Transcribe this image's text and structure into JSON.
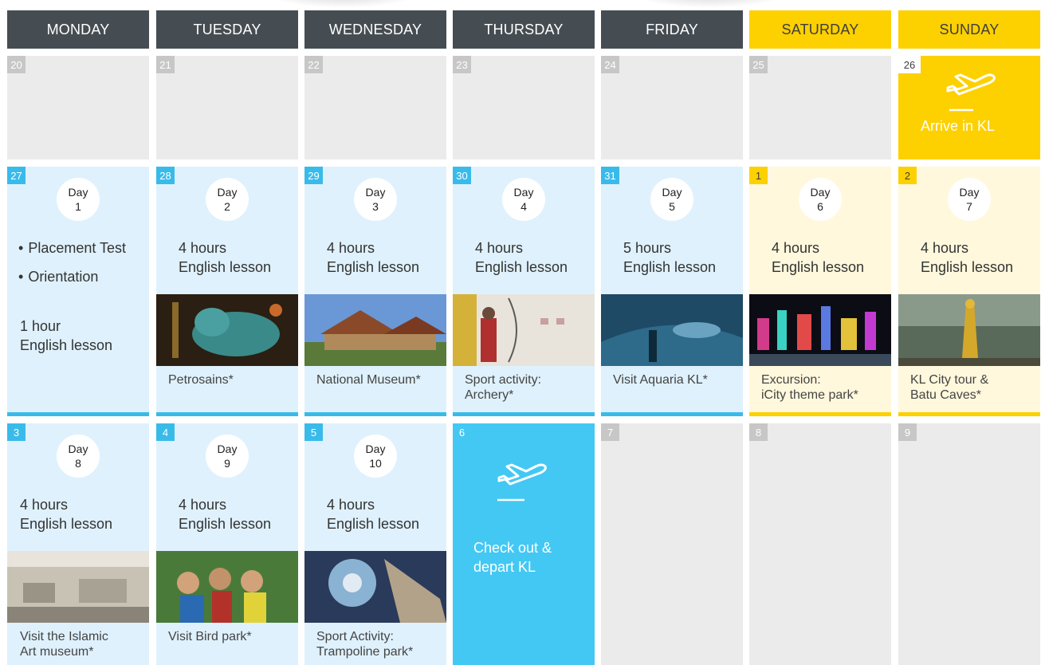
{
  "headers": [
    "MONDAY",
    "TUESDAY",
    "WEDNESDAY",
    "THURSDAY",
    "FRIDAY",
    "SATURDAY",
    "SUNDAY"
  ],
  "week1": {
    "dates": [
      "20",
      "21",
      "22",
      "23",
      "24",
      "25",
      "26"
    ],
    "arrive_label": "Arrive in KL"
  },
  "week2": {
    "dates": [
      "27",
      "28",
      "29",
      "30",
      "31",
      "1",
      "2"
    ],
    "day_word": "Day",
    "day_numbers": [
      "1",
      "2",
      "3",
      "4",
      "5",
      "6",
      "7"
    ],
    "monday_bullets": [
      "Placement Test",
      "Orientation"
    ],
    "monday_lesson": [
      "1 hour",
      "English lesson"
    ],
    "lessons": [
      [
        "4 hours",
        "English lesson"
      ],
      [
        "4 hours",
        "English lesson"
      ],
      [
        "4 hours",
        "English lesson"
      ],
      [
        "5 hours",
        "English lesson"
      ],
      [
        "4 hours",
        "English lesson"
      ],
      [
        "4 hours",
        "English lesson"
      ]
    ],
    "captions": [
      [
        "Petrosains*"
      ],
      [
        "National Museum*"
      ],
      [
        "Sport activity:",
        "Archery*"
      ],
      [
        "Visit Aquaria KL*"
      ],
      [
        "Excursion:",
        "iCity theme park*"
      ],
      [
        "KL City tour &",
        "Batu Caves*"
      ]
    ]
  },
  "week3": {
    "dates": [
      "3",
      "4",
      "5",
      "6",
      "7",
      "8",
      "9"
    ],
    "day_word": "Day",
    "day_numbers": [
      "8",
      "9",
      "10"
    ],
    "lessons": [
      [
        "4 hours",
        "English lesson"
      ],
      [
        "4 hours",
        "English lesson"
      ],
      [
        "4 hours",
        "English lesson"
      ]
    ],
    "captions": [
      [
        "Visit the Islamic",
        "Art museum*"
      ],
      [
        "Visit Bird park*"
      ],
      [
        "Sport Activity:",
        "Trampoline park*"
      ]
    ],
    "depart_label": [
      "Check out &",
      "depart KL"
    ]
  },
  "icons": {
    "plane": "airplane-icon",
    "bullet": "•"
  },
  "colors": {
    "header_weekday": "#464d52",
    "header_weekend": "#fdd000",
    "empty_cell": "#ebebeb",
    "lesson_blue": "#dff1fc",
    "accent_blue": "#39bbea",
    "depart_blue": "#43c8f3",
    "weekend_cream": "#fff8dc"
  }
}
